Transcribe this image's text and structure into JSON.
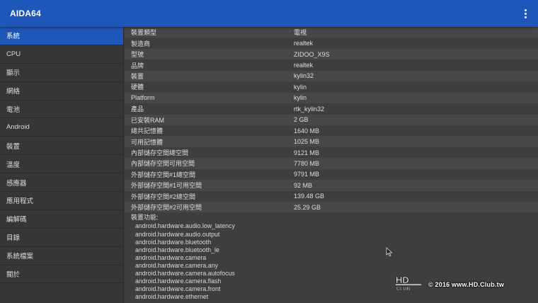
{
  "app": {
    "title": "AIDA64"
  },
  "sidebar": {
    "items": [
      {
        "label": "系統"
      },
      {
        "label": "CPU"
      },
      {
        "label": "顯示"
      },
      {
        "label": "網絡"
      },
      {
        "label": "電池"
      },
      {
        "label": "Android"
      },
      {
        "label": "裝置"
      },
      {
        "label": "溫度"
      },
      {
        "label": "感應器"
      },
      {
        "label": "應用程式"
      },
      {
        "label": "編解碼"
      },
      {
        "label": "目錄"
      },
      {
        "label": "系統檔案"
      },
      {
        "label": "關於"
      }
    ]
  },
  "properties": [
    {
      "key": "裝置類型",
      "value": "電視"
    },
    {
      "key": "製造商",
      "value": "realtek"
    },
    {
      "key": "型號",
      "value": "ZIDOO_X9S"
    },
    {
      "key": "品牌",
      "value": "realtek"
    },
    {
      "key": "裝置",
      "value": "kylin32"
    },
    {
      "key": "硬體",
      "value": "kylin"
    },
    {
      "key": "Platform",
      "value": "kylin"
    },
    {
      "key": "產品",
      "value": "rtk_kylin32"
    },
    {
      "key": "已安裝RAM",
      "value": "2 GB"
    },
    {
      "key": "總共記憶體",
      "value": "1640 MB"
    },
    {
      "key": "可用記憶體",
      "value": "1025 MB"
    },
    {
      "key": "內部儲存空間總空間",
      "value": "9121 MB"
    },
    {
      "key": "內部儲存空間可用空間",
      "value": "7780 MB"
    },
    {
      "key": "外部儲存空間#1總空間",
      "value": "9791 MB"
    },
    {
      "key": "外部儲存空間#1可用空間",
      "value": "92 MB"
    },
    {
      "key": "外部儲存空間#2總空間",
      "value": "139.48 GB"
    },
    {
      "key": "外部儲存空間#2可用空間",
      "value": "25.29 GB"
    }
  ],
  "features": {
    "title": "裝置功能:",
    "items": [
      "android.hardware.audio.low_latency",
      "android.hardware.audio.output",
      "android.hardware.bluetooth",
      "android.hardware.bluetooth_le",
      "android.hardware.camera",
      "android.hardware.camera.any",
      "android.hardware.camera.autofocus",
      "android.hardware.camera.flash",
      "android.hardware.camera.front",
      "android.hardware.ethernet"
    ]
  },
  "watermark": {
    "logo_top": "HD",
    "logo_bottom": "CLUB",
    "text": "© 2016  www.HD.Club.tw"
  },
  "colors": {
    "appbar": "#1e57b9",
    "selected": "#1e57b9",
    "background": "#3b3b3b"
  },
  "icons": {
    "overflow_menu": "more-vert-icon",
    "pointer": "mouse-cursor-icon"
  }
}
